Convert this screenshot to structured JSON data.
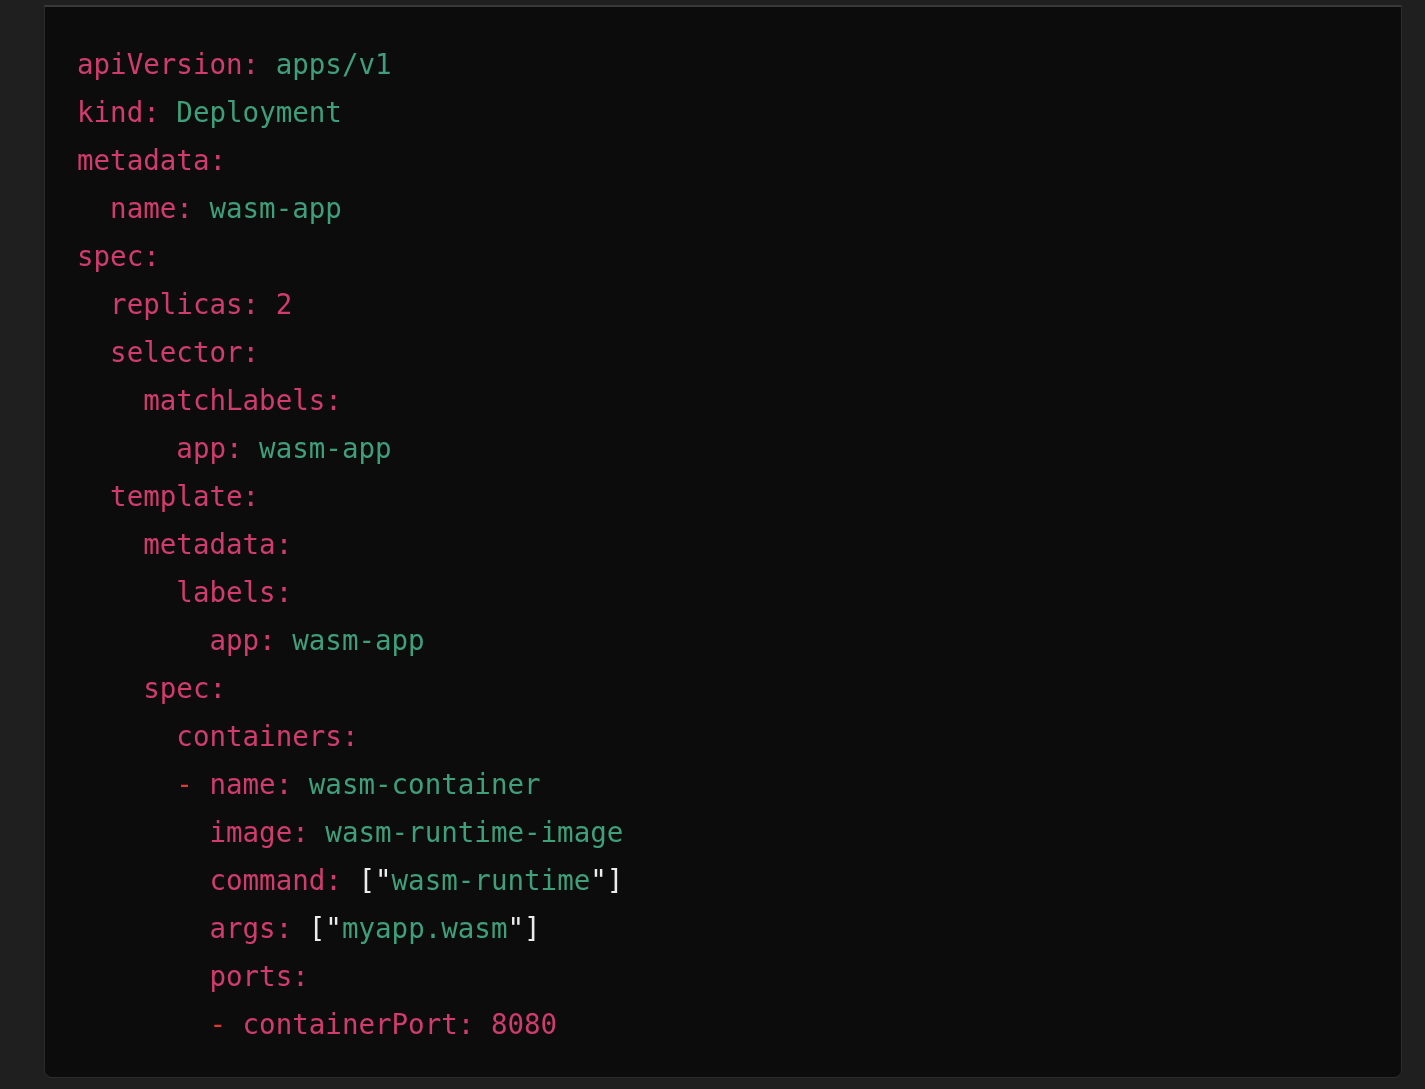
{
  "code_block": {
    "language_lines": [
      {
        "tokens": [
          {
            "kind": "key",
            "text": "apiVersion:"
          },
          {
            "kind": "value",
            "text": "apps/v1"
          }
        ]
      },
      {
        "tokens": [
          {
            "kind": "key",
            "text": "kind:"
          },
          {
            "kind": "value",
            "text": "Deployment"
          }
        ]
      },
      {
        "tokens": [
          {
            "kind": "key",
            "text": "metadata:"
          }
        ],
        "children": [
          {
            "tokens": [
              {
                "kind": "key",
                "text": "name:"
              },
              {
                "kind": "value",
                "text": "wasm-app"
              }
            ]
          }
        ]
      },
      {
        "tokens": [
          {
            "kind": "key",
            "text": "spec:"
          }
        ],
        "children": [
          {
            "tokens": [
              {
                "kind": "key",
                "text": "replicas:"
              },
              {
                "kind": "number",
                "text": "2"
              }
            ]
          },
          {
            "tokens": [
              {
                "kind": "key",
                "text": "selector:"
              }
            ],
            "children": [
              {
                "tokens": [
                  {
                    "kind": "key",
                    "text": "matchLabels:"
                  }
                ],
                "children": [
                  {
                    "tokens": [
                      {
                        "kind": "key",
                        "text": "app:"
                      },
                      {
                        "kind": "value",
                        "text": "wasm-app"
                      }
                    ]
                  }
                ]
              }
            ]
          },
          {
            "tokens": [
              {
                "kind": "key",
                "text": "template:"
              }
            ],
            "children": [
              {
                "tokens": [
                  {
                    "kind": "key",
                    "text": "metadata:"
                  }
                ],
                "children": [
                  {
                    "tokens": [
                      {
                        "kind": "key",
                        "text": "labels:"
                      }
                    ],
                    "children": [
                      {
                        "tokens": [
                          {
                            "kind": "key",
                            "text": "app:"
                          },
                          {
                            "kind": "value",
                            "text": "wasm-app"
                          }
                        ]
                      }
                    ]
                  }
                ]
              },
              {
                "tokens": [
                  {
                    "kind": "key",
                    "text": "spec:"
                  }
                ],
                "children": [
                  {
                    "tokens": [
                      {
                        "kind": "key",
                        "text": "containers:"
                      }
                    ]
                  },
                  {
                    "tokens": [
                      {
                        "kind": "dash",
                        "text": "-"
                      },
                      {
                        "kind": "key",
                        "text": "name:"
                      },
                      {
                        "kind": "value",
                        "text": "wasm-container"
                      }
                    ],
                    "children": [
                      {
                        "tokens": [
                          {
                            "kind": "key",
                            "text": "image:"
                          },
                          {
                            "kind": "value",
                            "text": "wasm-runtime-image"
                          }
                        ]
                      },
                      {
                        "tokens": [
                          {
                            "kind": "key",
                            "text": "command:"
                          },
                          {
                            "kind": "punct",
                            "text": "[\""
                          },
                          {
                            "kind": "value",
                            "text": "wasm-runtime"
                          },
                          {
                            "kind": "punct",
                            "text": "\"]"
                          }
                        ]
                      },
                      {
                        "tokens": [
                          {
                            "kind": "key",
                            "text": "args:"
                          },
                          {
                            "kind": "punct",
                            "text": "[\""
                          },
                          {
                            "kind": "value",
                            "text": "myapp.wasm"
                          },
                          {
                            "kind": "punct",
                            "text": "\"]"
                          }
                        ]
                      },
                      {
                        "tokens": [
                          {
                            "kind": "key",
                            "text": "ports:"
                          }
                        ]
                      },
                      {
                        "tokens": [
                          {
                            "kind": "dash",
                            "text": "-"
                          },
                          {
                            "kind": "key",
                            "text": "containerPort:"
                          },
                          {
                            "kind": "number",
                            "text": "8080"
                          }
                        ]
                      }
                    ]
                  }
                ]
              }
            ]
          }
        ]
      }
    ]
  }
}
